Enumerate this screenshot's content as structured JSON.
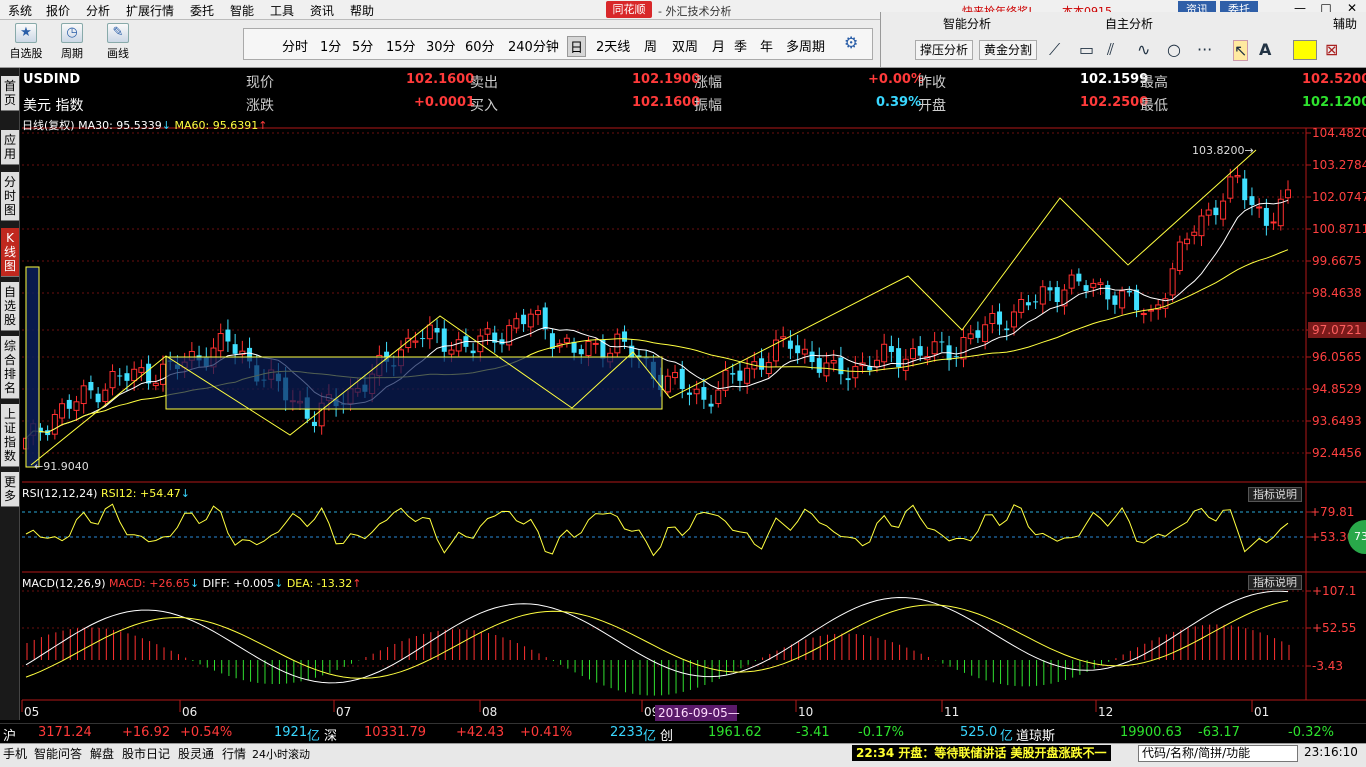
{
  "menu": [
    "系统",
    "报价",
    "分析",
    "扩展行情",
    "委托",
    "智能",
    "工具",
    "资讯",
    "帮助"
  ],
  "brand": {
    "logo": "同花顺",
    "subtitle": "- 外汇技术分析"
  },
  "top_right": {
    "promo": "快来抢年终奖!",
    "user": "本本0915",
    "btn1": "资讯",
    "btn2": "委托"
  },
  "window_buttons": [
    "—",
    "□",
    "✕"
  ],
  "toolbar": {
    "btn1": "自选股",
    "btn2": "周期",
    "btn3": "画线"
  },
  "periods": [
    "分时",
    "1分",
    "5分",
    "15分",
    "30分",
    "60分",
    "240分钟",
    "日",
    "2天线",
    "周",
    "双周",
    "月",
    "季",
    "年",
    "多周期"
  ],
  "period_selected": "日",
  "right_panel": {
    "smart": "智能分析",
    "self": "自主分析",
    "aux": "辅助",
    "btn_support": "撑压分析",
    "btn_golden": "黄金分割"
  },
  "left_tabs": [
    "首页",
    "应用",
    "分时图",
    "K线图",
    "自选股",
    "综合排名",
    "上证指数",
    "更多"
  ],
  "quote": {
    "symbol": "USDIND",
    "name": "美元 指数",
    "l1": "现价",
    "v1": "102.1600",
    "l2": "卖出",
    "v2": "102.1900",
    "l3": "涨幅",
    "v3": "+0.00%",
    "l4": "昨收",
    "v4": "102.1599",
    "l5": "最高",
    "v5": "102.5200",
    "l6": "涨跌",
    "v6": "+0.0001",
    "l7": "买入",
    "v7": "102.1600",
    "l8": "振幅",
    "v8": "0.39%",
    "l9": "开盘",
    "v9": "102.2500",
    "l10": "最低",
    "v10": "102.1200"
  },
  "ma_info": {
    "label": "日线(复权)",
    "ma30": "MA30: 95.5339",
    "ma30_arrow": "↓",
    "ma60": "MA60: 95.6391",
    "ma60_arrow": "↑"
  },
  "rsi_info": {
    "label": "RSI(12,12,24)",
    "val": "RSI12: +54.47",
    "arrow": "↓"
  },
  "macd_info": {
    "label": "MACD(12,26,9)",
    "macd": "MACD: +26.65",
    "macd_arrow": "↓",
    "diff": "DIFF: +0.005",
    "diff_arrow": "↓",
    "dea": "DEA: -13.32",
    "dea_arrow": "↑"
  },
  "indicator_btn": "指标说明",
  "circle_val": "73",
  "chart_data": {
    "type": "candlestick",
    "price_ticks": [
      "104.4820",
      "103.2784",
      "102.0747",
      "100.8711",
      "99.6675",
      "98.4638",
      "97.0721",
      "96.0565",
      "94.8529",
      "93.6493",
      "92.4456"
    ],
    "price_tick_values": [
      104.482,
      103.2784,
      102.0747,
      100.8711,
      99.6675,
      98.4638,
      97.0721,
      96.0565,
      94.8529,
      93.6493,
      92.4456
    ],
    "current_price_label": "97.0721",
    "high_label": "103.8200",
    "low_label": "91.9040",
    "rsi_ticks": [
      "79.81",
      "53.30"
    ],
    "macd_ticks": [
      "107.1",
      "52.55",
      "-3.43"
    ],
    "x_labels": [
      "05",
      "06",
      "07",
      "08",
      "09",
      "10",
      "11",
      "12",
      "01"
    ],
    "cursor_date": "2016-09-05"
  },
  "status": {
    "sh": "沪",
    "sh_val": "3171.24",
    "sh_chg": "+16.92",
    "sh_pct": "+0.54%",
    "sh_amt": "1921",
    "yi": "亿",
    "sz": "深",
    "sz_val": "10331.79",
    "sz_chg": "+42.43",
    "sz_pct": "+0.41%",
    "sz_amt": "2233",
    "cy": "创",
    "cy_val": "1961.62",
    "cy_chg": "-3.41",
    "cy_pct": "-0.17%",
    "cy_amt": "525.0",
    "dj": "道琼斯",
    "dj_val": "19900.63",
    "dj_chg": "-63.17",
    "dj_pct": "-0.32%"
  },
  "bottom": {
    "items": [
      "手机",
      "智能问答",
      "解盘",
      "股市日记",
      "股灵通",
      "行情",
      "24小时滚动"
    ],
    "ticker": "22:34 开盘：等待联储讲话 美股开盘涨跌不一",
    "code_ph": "代码/名称/简拼/功能",
    "clock": "23:16:10"
  }
}
